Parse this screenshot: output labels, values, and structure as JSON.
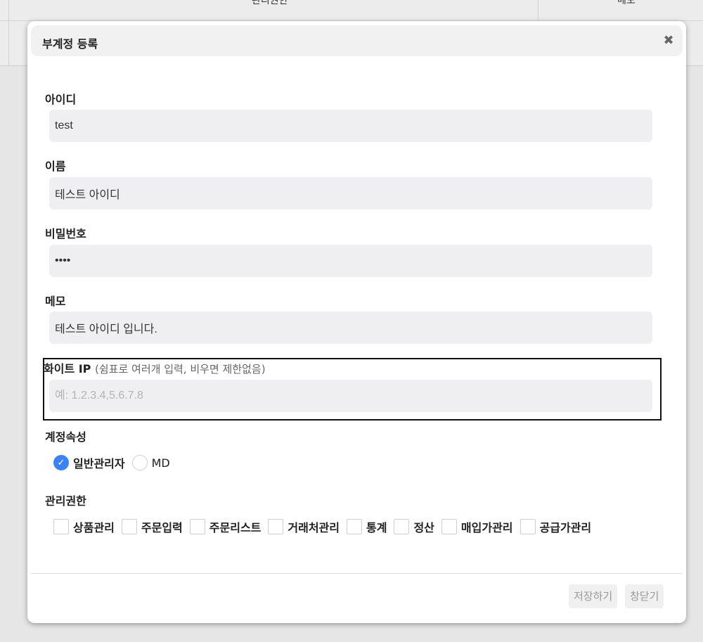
{
  "background_table": {
    "header_col_a": "관리권한",
    "header_col_b": "메모"
  },
  "modal": {
    "title": "부계정 등록",
    "close_icon": "close-x-icon"
  },
  "form": {
    "id": {
      "label": "아이디",
      "value": "test"
    },
    "name": {
      "label": "이름",
      "value": "테스트 아이디"
    },
    "password": {
      "label": "비밀번호",
      "value": "1234"
    },
    "memo": {
      "label": "메모",
      "value": "테스트 아이디 입니다."
    },
    "white_ip": {
      "label": "화이트 IP",
      "hint": "(쉼표로 여러개 입력, 비우면 제한없음)",
      "value": "",
      "placeholder": "예: 1.2.3.4,5.6.7.8"
    },
    "account_type": {
      "label": "계정속성",
      "options": [
        {
          "label": "일반관리자",
          "checked": true
        },
        {
          "label": "MD",
          "checked": false
        }
      ]
    },
    "permissions": {
      "label": "관리권한",
      "options": [
        "상품관리",
        "주문입력",
        "주문리스트",
        "거래처관리",
        "통계",
        "정산",
        "매입가관리",
        "공급가관리"
      ]
    }
  },
  "footer": {
    "save_label": "저장하기",
    "close_label": "창닫기"
  },
  "colors": {
    "accent": "#3b82f6",
    "input_bg": "#efeff1",
    "header_bg": "#f1f1f1"
  }
}
